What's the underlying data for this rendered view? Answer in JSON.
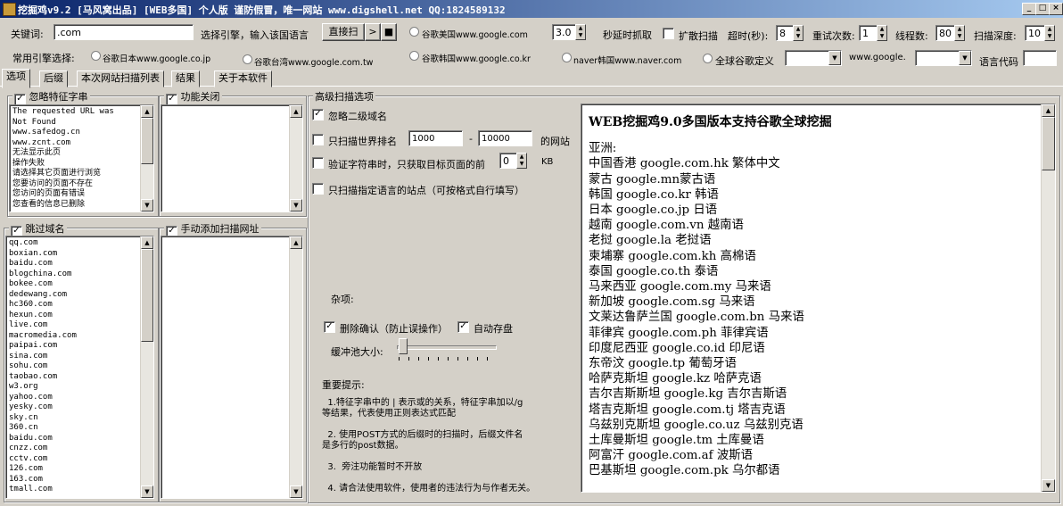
{
  "window": {
    "title": "挖掘鸡v9.2 [马风窝出品] [WEB多国] 个人版 谨防假冒，唯一网站 www.digshell.net QQ:1824589132",
    "minimize_label": "_",
    "maximize_label": "□",
    "close_label": "×"
  },
  "toolbar": {
    "keyword_label": "关键词:",
    "keyword_value": ".com",
    "engine_hint": "选择引擎，输入该国语言",
    "direct_scan_label": "直接扫",
    "play_glyph": ">",
    "stop_glyph": "■",
    "google_us_label": "谷歌美国www.google.com",
    "delay_value": "3.0",
    "delay_label": "秒延时抓取",
    "expand_scan_label": "扩散扫描",
    "timeout_label": "超时(秒):",
    "timeout_value": "8",
    "retry_label": "重试次数:",
    "retry_value": "1",
    "threads_label": "线程数:",
    "threads_value": "80",
    "depth_label": "扫描深度:",
    "depth_value": "10",
    "engine_select_label": "常用引擎选择:",
    "google_jp_label": "谷歌日本www.google.co.jp",
    "google_tw_label": "谷歌台湾www.google.com.tw",
    "google_kr_label": "谷歌韩国www.google.co.kr",
    "naver_label": "naver韩国www.naver.com",
    "global_google_label": "全球谷歌定义",
    "google_prefix": "www.google.",
    "lang_code_label": "语言代码"
  },
  "tabs": [
    {
      "label": "选项"
    },
    {
      "label": "后缀"
    },
    {
      "label": "本次网站扫描列表"
    },
    {
      "label": "结果"
    },
    {
      "label": "关于本软件"
    }
  ],
  "ignore_strings": {
    "title": "忽略特征字串",
    "items": [
      "The requested URL was",
      "Not Found",
      "www.safedog.cn",
      "www.zcnt.com",
      "无法显示此页",
      "操作失败",
      "请选择其它页面进行浏览",
      "您要访问的页面不存在",
      "您访问的页面有错误",
      "您查看的信息已删除"
    ]
  },
  "feature_off": {
    "title": "功能关闭"
  },
  "skip_domains": {
    "title": "跳过域名",
    "items": [
      "qq.com",
      "boxian.com",
      "baidu.com",
      "blogchina.com",
      "bokee.com",
      "dedewang.com",
      "hc360.com",
      "hexun.com",
      "live.com",
      "macromedia.com",
      "paipai.com",
      "sina.com",
      "sohu.com",
      "taobao.com",
      "w3.org",
      "yahoo.com",
      "yesky.com",
      "sky.cn",
      "360.cn",
      "baidu.com",
      "cnzz.com",
      "cctv.com",
      "126.com",
      "163.com",
      "tmall.com"
    ]
  },
  "manual_add": {
    "title": "手动添加扫描网址"
  },
  "advanced": {
    "title": "高级扫描选项",
    "ignore_subdomain": "忽略二级域名",
    "rank_label": "只扫描世界排名",
    "rank_from": "1000",
    "rank_dash": "-",
    "rank_to": "10000",
    "rank_suffix": "的网站",
    "verify_label": "验证字符串时，只获取目标页面的前",
    "verify_value": "0",
    "verify_unit": "KB",
    "lang_only_label": "只扫描指定语言的站点（可按格式自行填写）",
    "misc_label": "杂项:",
    "confirm_delete": "删除确认（防止误操作）",
    "auto_save": "自动存盘",
    "buffer_label": "缓冲池大小:",
    "notes_title": "重要提示:",
    "notes": [
      "  1.特征字串中的 | 表示或的关系，特征字串加以/g\n等结果，代表使用正则表达式匹配",
      "  2. 使用POST方式的后缀时的扫描时，后缀文件名\n是多行的post数据。",
      "  3.  旁注功能暂时不开放",
      "  4. 请合法使用软件，使用者的违法行为与作者无关。"
    ]
  },
  "info_panel": {
    "heading": "WEB挖掘鸡9.0多国版本支持谷歌全球挖掘",
    "region": "亚洲:",
    "lines": [
      "中国香港 google.com.hk 繁体中文",
      "蒙古 google.mn蒙古语",
      "韩国 google.co.kr 韩语",
      "日本 google.co.jp 日语",
      "越南 google.com.vn 越南语",
      "老挝 google.la 老挝语",
      "柬埔寨 google.com.kh 高棉语",
      "泰国 google.co.th 泰语",
      "马来西亚 google.com.my 马来语",
      "新加坡 google.com.sg 马来语",
      "文莱达鲁萨兰国 google.com.bn 马来语",
      "菲律宾 google.com.ph 菲律宾语",
      "印度尼西亚 google.co.id 印尼语",
      "东帝汶 google.tp 葡萄牙语",
      "哈萨克斯坦 google.kz 哈萨克语",
      "吉尔吉斯斯坦 google.kg 吉尔吉斯语",
      "塔吉克斯坦 google.com.tj 塔吉克语",
      "乌兹别克斯坦 google.co.uz 乌兹别克语",
      "土库曼斯坦 google.tm 土库曼语",
      "阿富汗 google.com.af 波斯语",
      "巴基斯坦 google.com.pk 乌尔都语"
    ]
  }
}
